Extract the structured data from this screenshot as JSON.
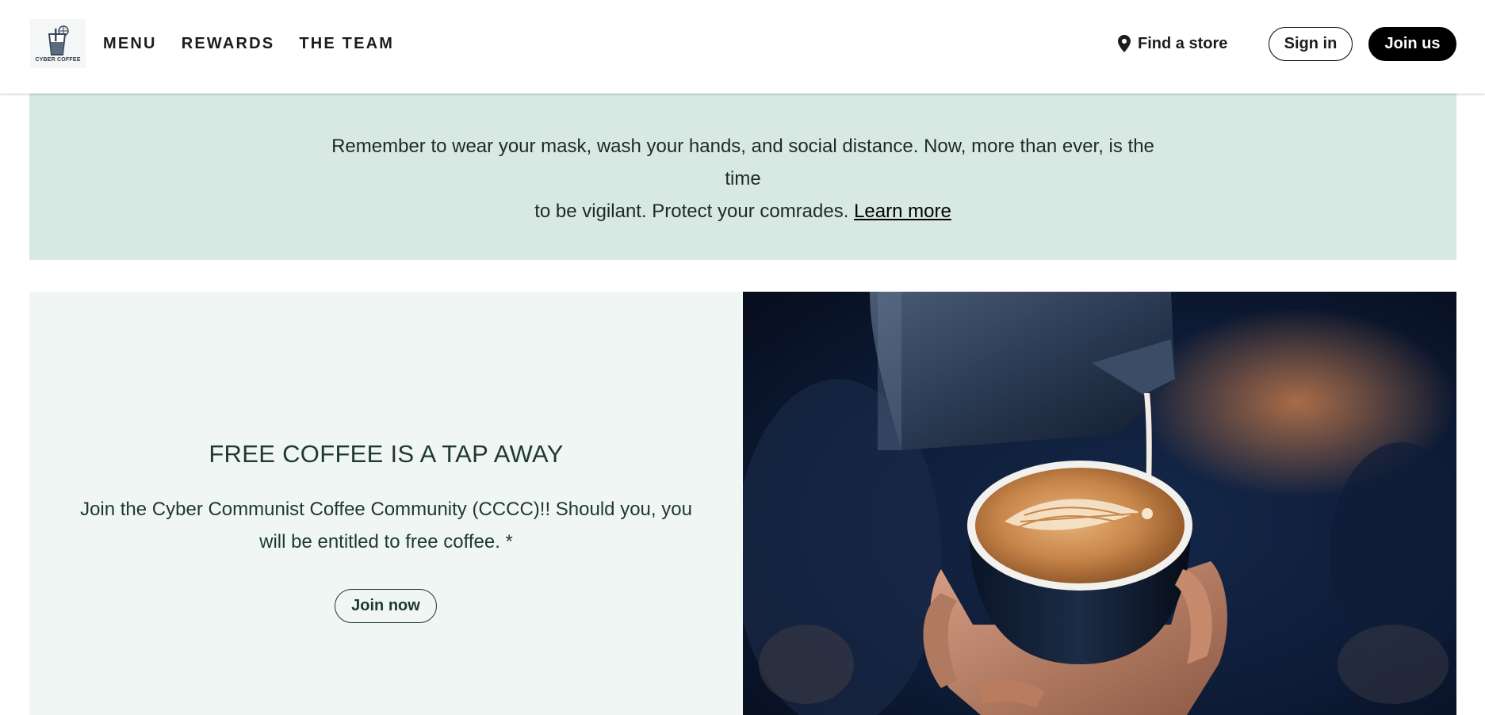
{
  "header": {
    "logo_text": "CYBER COFFEE",
    "nav": [
      "MENU",
      "REWARDS",
      "THE TEAM"
    ],
    "find_store": "Find a store",
    "sign_in": "Sign in",
    "join_us": "Join us"
  },
  "banner": {
    "line1": "Remember to wear your mask, wash your hands, and social distance. Now, more than ever, is the time",
    "line2": "to be vigilant. Protect your comrades.",
    "link": "Learn more"
  },
  "promo": {
    "title": "FREE COFFEE IS A TAP AWAY",
    "body": "Join the Cyber Communist Coffee Community (CCCC)!! Should you, you will be entitled to free coffee. *",
    "button": "Join now"
  },
  "icons": {
    "logo": "coffee-glass-icon",
    "find_store": "location-pin-icon"
  },
  "colors": {
    "banner_bg": "#d8e8e2",
    "promo_bg": "#f0f6f4",
    "text_green": "#1e3932",
    "black": "#000000"
  }
}
